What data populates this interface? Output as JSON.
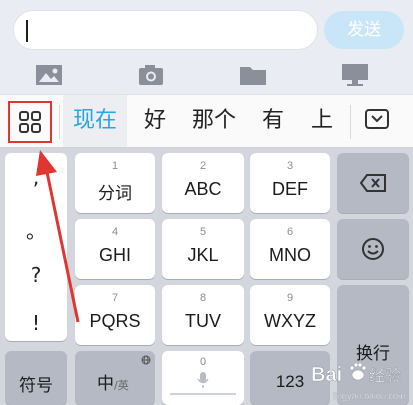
{
  "input_bar": {
    "input_value": "",
    "send_label": "发送"
  },
  "attachments": {
    "icons": [
      "image-icon",
      "camera-icon",
      "folder-icon",
      "desktop-icon"
    ]
  },
  "candidates": {
    "items": [
      "现在",
      "好",
      "那个",
      "有",
      "上"
    ]
  },
  "keyboard": {
    "punctuation": [
      ",",
      "。",
      "?",
      "!"
    ],
    "keys": [
      {
        "num": "1",
        "label": "分词"
      },
      {
        "num": "2",
        "label": "ABC"
      },
      {
        "num": "3",
        "label": "DEF"
      },
      {
        "num": "4",
        "label": "GHI"
      },
      {
        "num": "5",
        "label": "JKL"
      },
      {
        "num": "6",
        "label": "MNO"
      },
      {
        "num": "7",
        "label": "PQRS"
      },
      {
        "num": "8",
        "label": "TUV"
      },
      {
        "num": "9",
        "label": "WXYZ"
      }
    ],
    "symbols_label": "符号",
    "lang_main": "中",
    "lang_alt": "/英",
    "space_num": "0",
    "num_label": "123",
    "enter_label": "换行"
  },
  "watermark": {
    "brand": "Bai",
    "brand_suffix": "经验",
    "url": "jingyan.baidu.com"
  },
  "colors": {
    "highlight": "#27a6e0",
    "annotation": "#e03530"
  }
}
